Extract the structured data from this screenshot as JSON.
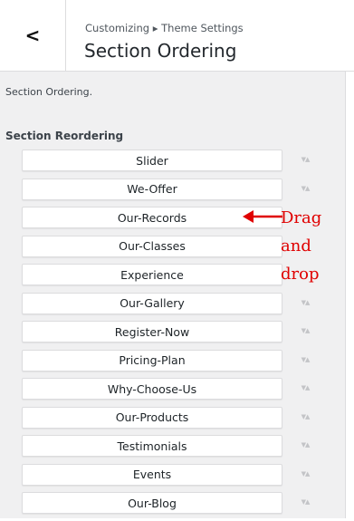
{
  "header": {
    "back_label": "<",
    "breadcrumb": "Customizing ▸ Theme Settings",
    "title": "Section Ordering"
  },
  "panel": {
    "description": "Section Ordering.",
    "heading": "Section Reordering",
    "items": [
      {
        "label": "Slider"
      },
      {
        "label": "We-Offer"
      },
      {
        "label": "Our-Records"
      },
      {
        "label": "Our-Classes"
      },
      {
        "label": "Experience"
      },
      {
        "label": "Our-Gallery"
      },
      {
        "label": "Register-Now"
      },
      {
        "label": "Pricing-Plan"
      },
      {
        "label": "Why-Choose-Us"
      },
      {
        "label": "Our-Products"
      },
      {
        "label": "Testimonials"
      },
      {
        "label": "Events"
      },
      {
        "label": "Our-Blog"
      }
    ],
    "sort_arrows": "▼▲"
  },
  "annotation": {
    "lines": [
      "Drag",
      "and",
      "drop"
    ],
    "color": "#e00000"
  }
}
